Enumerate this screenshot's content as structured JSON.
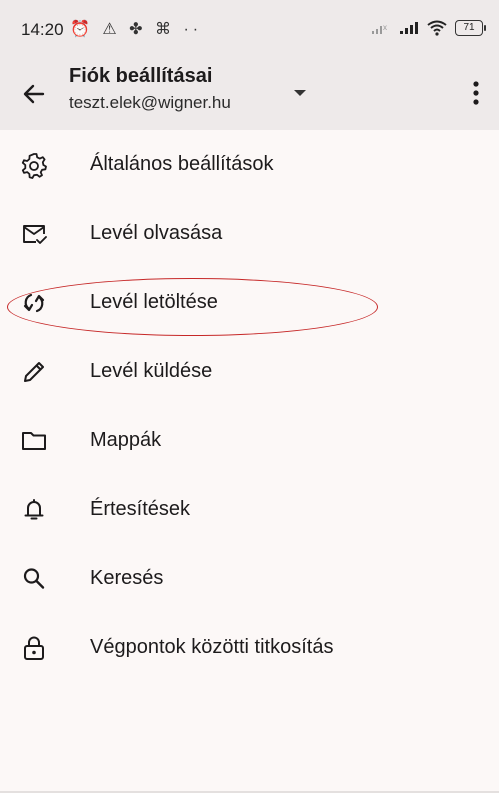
{
  "status_bar": {
    "time": "14:20",
    "left_icons": "⏰ ⚠ ✤ ⌘ ··",
    "battery": "71"
  },
  "app_bar": {
    "title": "Fiók beállításai",
    "email": "teszt.elek@wigner.hu"
  },
  "menu": {
    "items": [
      {
        "label": "Általános beállítások",
        "icon": "gear-icon"
      },
      {
        "label": "Levél olvasása",
        "icon": "mail-check-icon"
      },
      {
        "label": "Levél letöltése",
        "icon": "sync-icon"
      },
      {
        "label": "Levél küldése",
        "icon": "pencil-icon"
      },
      {
        "label": "Mappák",
        "icon": "folder-icon"
      },
      {
        "label": "Értesítések",
        "icon": "bell-icon"
      },
      {
        "label": "Keresés",
        "icon": "search-icon"
      },
      {
        "label": "Végpontok közötti titkosítás",
        "icon": "lock-icon"
      }
    ]
  },
  "colors": {
    "background": "#fcf8f7",
    "bar": "#eeeaea",
    "highlight": "#c62828"
  }
}
